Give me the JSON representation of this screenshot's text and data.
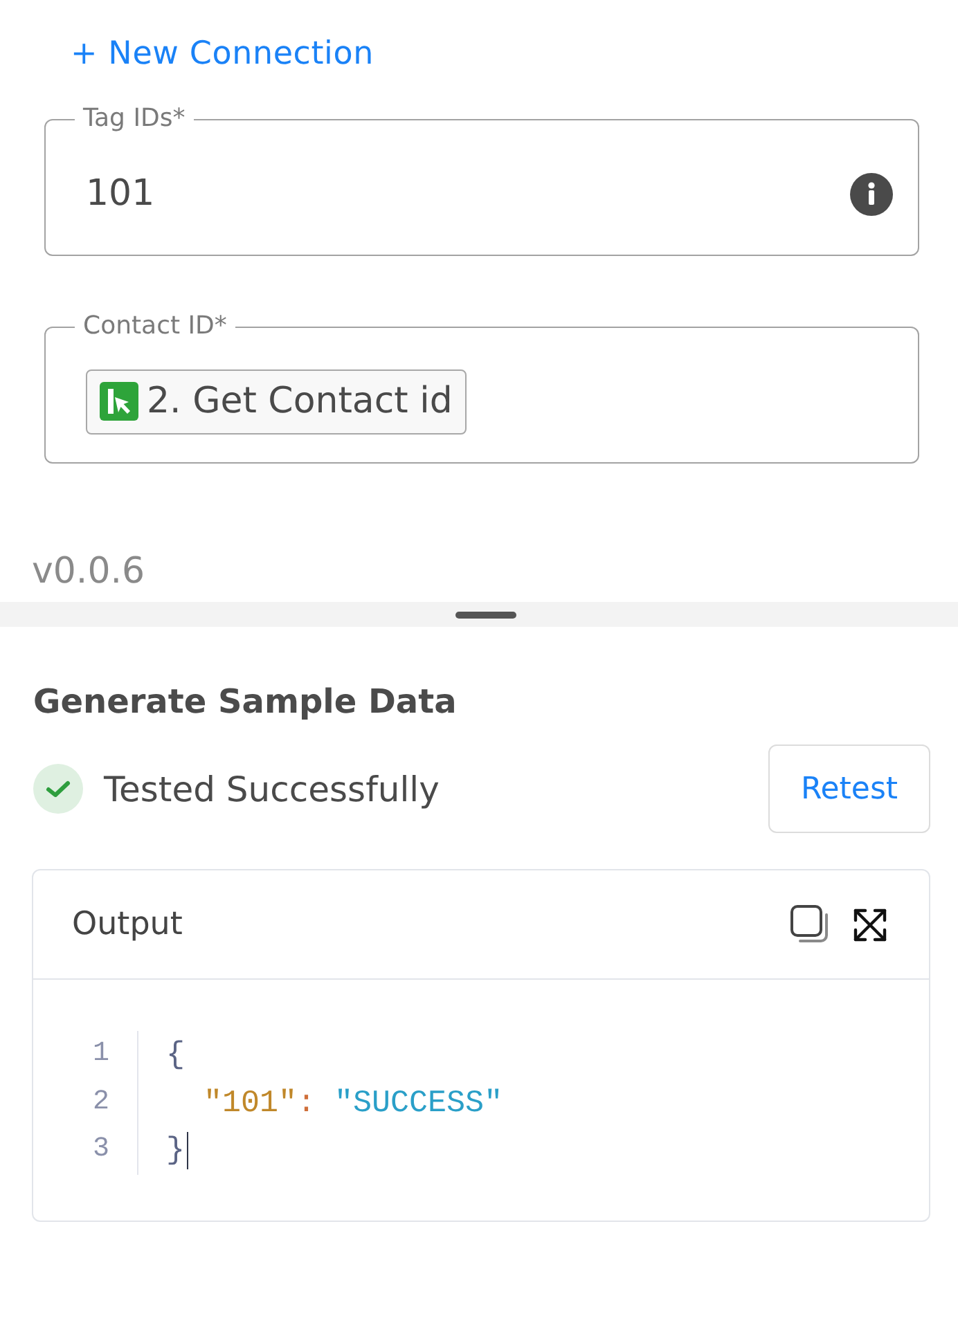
{
  "new_connection_link": "+ New Connection",
  "fields": [
    {
      "kind": "text",
      "label": "Tag IDs*",
      "value": "101",
      "info": true
    },
    {
      "kind": "token",
      "label": "Contact ID*",
      "token": {
        "text": "2. Get Contact id"
      },
      "info": false
    }
  ],
  "version": "v0.0.6",
  "sample_data": {
    "title": "Generate Sample Data",
    "status": {
      "passed": true,
      "text": "Tested Successfully"
    },
    "retest_button": "Retest"
  },
  "output": {
    "title": "Output",
    "lines": [
      {
        "number": "1",
        "tokens": [
          {
            "kind": "brace",
            "text": "{"
          }
        ],
        "cursor": false
      },
      {
        "number": "2",
        "tokens": [
          {
            "kind": "key",
            "text": "\"101\""
          },
          {
            "kind": "colon",
            "text": ":"
          },
          {
            "kind": "string",
            "text": "\"SUCCESS\""
          }
        ],
        "cursor": false
      },
      {
        "number": "3",
        "tokens": [
          {
            "kind": "brace",
            "text": "}"
          }
        ],
        "cursor": true
      }
    ]
  }
}
